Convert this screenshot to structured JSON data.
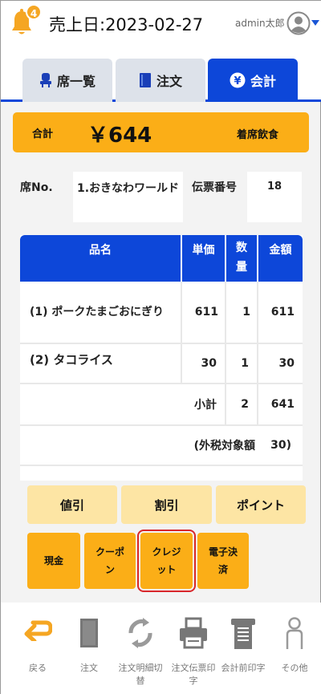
{
  "header": {
    "notification_count": "4",
    "sales_date": "売上日:2023-02-27",
    "user_name": "admin太郎"
  },
  "tabs": [
    {
      "label": "席一覧",
      "icon": "seat-icon",
      "active": false
    },
    {
      "label": "注文",
      "icon": "book-icon",
      "active": false
    },
    {
      "label": "会計",
      "icon": "yen-icon",
      "active": true
    }
  ],
  "total": {
    "label": "合計",
    "amount": "￥644",
    "type": "着席飲食"
  },
  "seat": {
    "label": "席No.",
    "value": "1.おきなわワールド",
    "slip_label": "伝票番号",
    "slip_value": "18"
  },
  "table": {
    "headers": {
      "name": "品名",
      "unit_price": "単価",
      "qty_1": "数",
      "qty_2": "量",
      "amount": "金額"
    },
    "items": [
      {
        "name": "(1) ポークたまごおにぎり",
        "unit_price": "611",
        "qty": "1",
        "amount": "611"
      },
      {
        "name": "(2) タコライス",
        "unit_price": "30",
        "qty": "1",
        "amount": "30"
      }
    ],
    "subtotal": {
      "label": "小計",
      "qty": "2",
      "amount": "641"
    },
    "taxable": {
      "label": "(外税対象額",
      "amount": "30)"
    }
  },
  "actions": {
    "discount_value": "値引",
    "discount_rate": "割引",
    "points": "ポイント",
    "cash": "現金",
    "coupon": "クーポン",
    "credit": "クレジット",
    "emoney": "電子決済"
  },
  "colors": {
    "accent": "#0d47d9",
    "orange": "#fbae17",
    "light_orange": "#fde5a4",
    "selected_outline": "#d8262b"
  },
  "bottom_nav": [
    {
      "label": "戻る",
      "icon": "back-arrow-icon"
    },
    {
      "label": "注文",
      "icon": "document-icon"
    },
    {
      "label": "注文明細切替",
      "icon": "refresh-icon"
    },
    {
      "label": "注文伝票印字",
      "icon": "printer-icon"
    },
    {
      "label": "会計前印字",
      "icon": "receipt-icon"
    },
    {
      "label": "その他",
      "icon": "person-icon"
    }
  ]
}
